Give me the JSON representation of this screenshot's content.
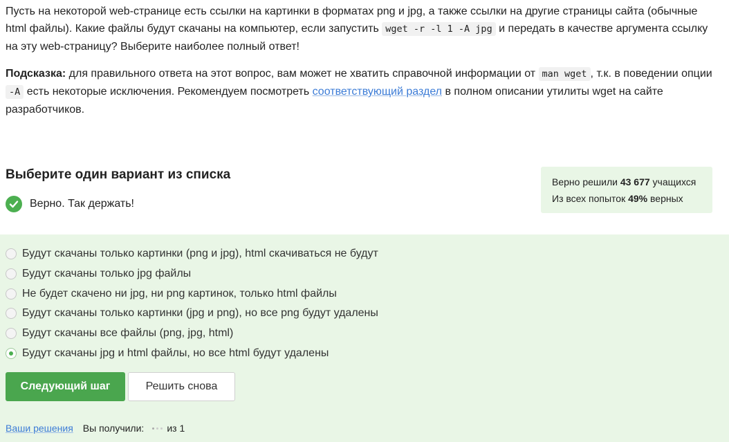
{
  "question": {
    "p1_a": "Пусть на некоторой web-странице есть ссылки на картинки в форматах png и jpg, а также ссылки на другие страницы сайта (обычные html файлы). Какие файлы будут скачаны на компьютер, если запустить ",
    "p1_code": "wget -r -l 1 -A jpg",
    "p1_b": " и передать в качестве аргумента ссылку на эту web-страницу? Выберите наиболее полный ответ!",
    "hint_label": "Подсказка:",
    "hint_a": " для правильного ответа на этот вопрос, вам может не хватить справочной информации от ",
    "hint_code1": "man wget",
    "hint_b": ", т.к. в поведении опции ",
    "hint_code2": "-A",
    "hint_c": " есть некоторые исключения. Рекомендуем посмотреть ",
    "hint_link": "соответствующий раздел",
    "hint_d": " в полном описании утилиты wget на сайте разработчиков."
  },
  "choose_title": "Выберите один вариант из списка",
  "result_text": "Верно. Так держать!",
  "stats": {
    "solved_prefix": "Верно решили ",
    "solved_count": "43 677",
    "solved_suffix": " учащихся",
    "attempts_prefix": "Из всех попыток ",
    "attempts_pct": "49%",
    "attempts_suffix": " верных"
  },
  "options": [
    {
      "label": "Будут скачаны только картинки (png и jpg), html скачиваться не будут",
      "selected": false
    },
    {
      "label": "Будут скачаны только jpg файлы",
      "selected": false
    },
    {
      "label": "Не будет скачено ни jpg, ни png картинок, только html файлы",
      "selected": false
    },
    {
      "label": "Будут скачаны только картинки (jpg и png), но все png будут удалены",
      "selected": false
    },
    {
      "label": "Будут скачаны все файлы (png, jpg, html)",
      "selected": false
    },
    {
      "label": "Будут скачаны jpg и html файлы, но все html будут удалены",
      "selected": true
    }
  ],
  "buttons": {
    "next": "Следующий шаг",
    "retry": "Решить снова"
  },
  "footer": {
    "solutions_link": "Ваши решения",
    "got_label": "Вы получили:",
    "of_label": "из 1"
  },
  "colors": {
    "accent_green": "#4aa64e",
    "panel_bg": "#e9f6e6",
    "link_blue": "#3b7bd6"
  }
}
